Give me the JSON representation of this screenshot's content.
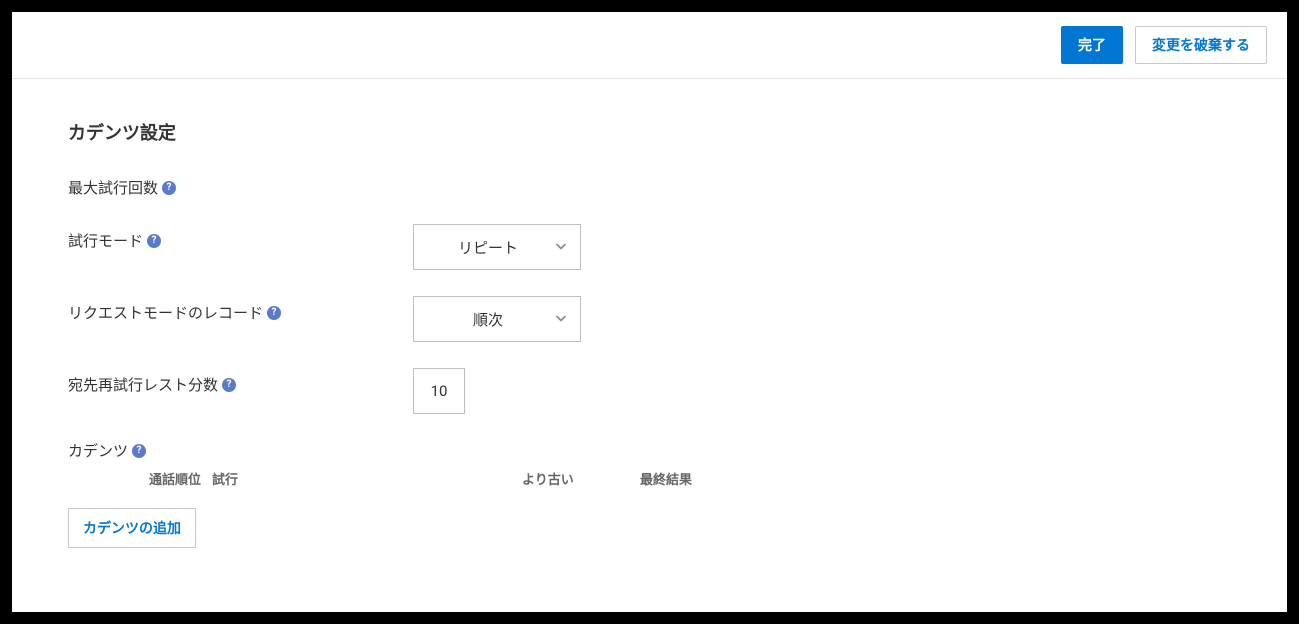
{
  "toolbar": {
    "done_label": "完了",
    "discard_label": "変更を破棄する"
  },
  "section": {
    "title": "カデンツ設定"
  },
  "fields": {
    "max_attempts": {
      "label": "最大試行回数"
    },
    "attempt_mode": {
      "label": "試行モード",
      "value": "リピート"
    },
    "request_mode_record": {
      "label": "リクエストモードのレコード",
      "value": "順次"
    },
    "dest_retry_rest_minutes": {
      "label": "宛先再試行レスト分数",
      "value": "10"
    },
    "cadence": {
      "label": "カデンツ"
    }
  },
  "table": {
    "headers": {
      "rank": "通話順位",
      "attempt": "試行",
      "older": "より古い",
      "final": "最終結果"
    },
    "add_label": "カデンツの追加"
  },
  "help": "?"
}
